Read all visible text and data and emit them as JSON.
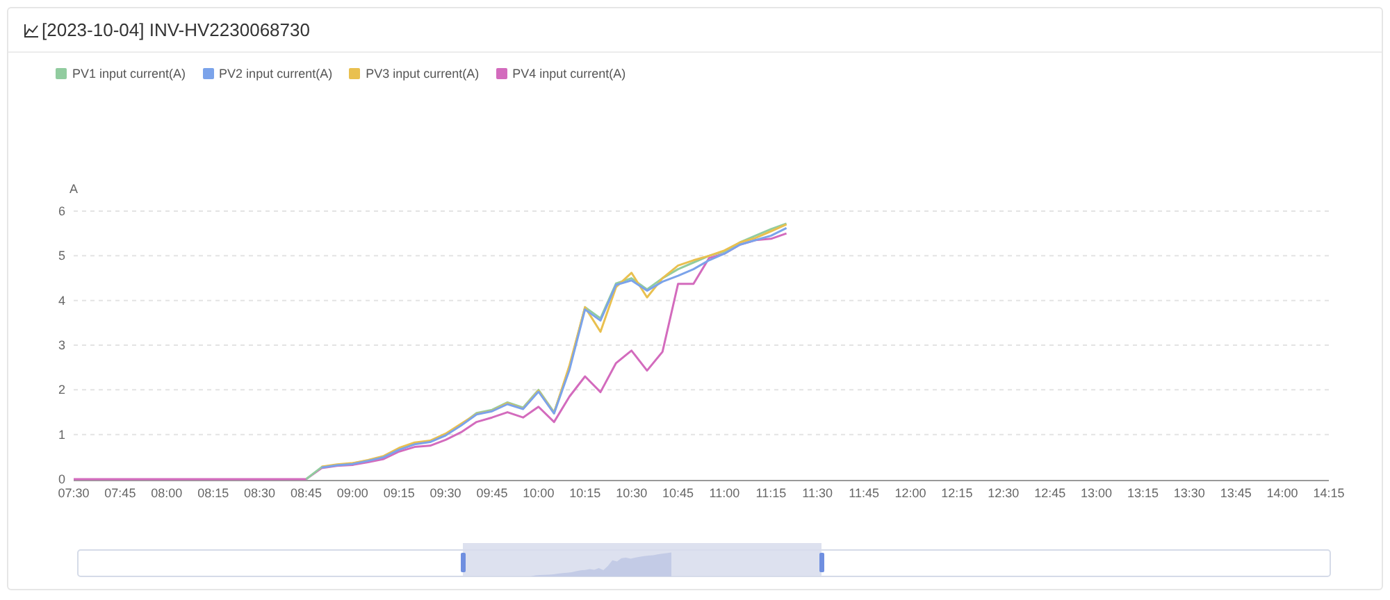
{
  "panel": {
    "title": "[2023-10-04] INV-HV2230068730"
  },
  "chart_data": {
    "type": "line",
    "grid": true,
    "ylabel": "A",
    "yticks": [
      0,
      1,
      2,
      3,
      4,
      5,
      6
    ],
    "ylim": [
      0,
      6
    ],
    "xlim": [
      450,
      855
    ],
    "xticks": [
      {
        "value": 450,
        "label": "07:30"
      },
      {
        "value": 465,
        "label": "07:45"
      },
      {
        "value": 480,
        "label": "08:00"
      },
      {
        "value": 495,
        "label": "08:15"
      },
      {
        "value": 510,
        "label": "08:30"
      },
      {
        "value": 525,
        "label": "08:45"
      },
      {
        "value": 540,
        "label": "09:00"
      },
      {
        "value": 555,
        "label": "09:15"
      },
      {
        "value": 570,
        "label": "09:30"
      },
      {
        "value": 585,
        "label": "09:45"
      },
      {
        "value": 600,
        "label": "10:00"
      },
      {
        "value": 615,
        "label": "10:15"
      },
      {
        "value": 630,
        "label": "10:30"
      },
      {
        "value": 645,
        "label": "10:45"
      },
      {
        "value": 660,
        "label": "11:00"
      },
      {
        "value": 675,
        "label": "11:15"
      },
      {
        "value": 690,
        "label": "11:30"
      },
      {
        "value": 705,
        "label": "11:45"
      },
      {
        "value": 720,
        "label": "12:00"
      },
      {
        "value": 735,
        "label": "12:15"
      },
      {
        "value": 750,
        "label": "12:30"
      },
      {
        "value": 765,
        "label": "12:45"
      },
      {
        "value": 780,
        "label": "13:00"
      },
      {
        "value": 795,
        "label": "13:15"
      },
      {
        "value": 810,
        "label": "13:30"
      },
      {
        "value": 825,
        "label": "13:45"
      },
      {
        "value": 840,
        "label": "14:00"
      },
      {
        "value": 855,
        "label": "14:15"
      }
    ],
    "x": [
      450,
      455,
      460,
      465,
      470,
      475,
      480,
      485,
      490,
      495,
      500,
      505,
      510,
      515,
      520,
      525,
      530,
      535,
      540,
      545,
      550,
      555,
      560,
      565,
      570,
      575,
      580,
      585,
      590,
      595,
      600,
      605,
      610,
      615,
      620,
      625,
      630,
      635,
      640,
      645,
      650,
      655,
      660,
      665,
      670,
      675,
      680
    ],
    "series": [
      {
        "name": "PV1 input current(A)",
        "color": "#91cc9f",
        "values": [
          null,
          null,
          null,
          null,
          null,
          null,
          null,
          null,
          null,
          null,
          null,
          null,
          null,
          null,
          null,
          0,
          0.27,
          0.32,
          0.35,
          0.42,
          0.5,
          0.68,
          0.8,
          0.85,
          1.0,
          1.22,
          1.48,
          1.55,
          1.72,
          1.6,
          2.0,
          1.5,
          2.5,
          3.85,
          3.6,
          4.38,
          4.5,
          4.25,
          4.5,
          4.7,
          4.85,
          5.0,
          5.1,
          5.3,
          5.45,
          5.6,
          5.72
        ]
      },
      {
        "name": "PV2 input current(A)",
        "color": "#7ba3ea",
        "values": [
          null,
          null,
          null,
          null,
          null,
          null,
          null,
          null,
          null,
          null,
          null,
          null,
          null,
          null,
          null,
          null,
          0.26,
          0.31,
          0.34,
          0.41,
          0.49,
          0.66,
          0.78,
          0.83,
          0.98,
          1.2,
          1.45,
          1.52,
          1.68,
          1.57,
          1.96,
          1.47,
          2.45,
          3.8,
          3.55,
          4.35,
          4.45,
          4.22,
          4.42,
          4.55,
          4.7,
          4.9,
          5.05,
          5.25,
          5.35,
          5.45,
          5.62
        ]
      },
      {
        "name": "PV3 input current(A)",
        "color": "#e9c04f",
        "values": [
          null,
          null,
          null,
          null,
          null,
          null,
          null,
          null,
          null,
          null,
          null,
          null,
          null,
          null,
          null,
          null,
          0.28,
          0.33,
          0.36,
          0.43,
          0.52,
          0.7,
          0.82,
          0.86,
          1.02,
          1.24,
          1.46,
          1.53,
          1.7,
          1.58,
          1.98,
          1.48,
          2.55,
          3.85,
          3.3,
          4.3,
          4.62,
          4.07,
          4.5,
          4.78,
          4.9,
          5.0,
          5.12,
          5.3,
          5.4,
          5.55,
          5.7
        ]
      },
      {
        "name": "PV4 input current(A)",
        "color": "#d36bbd",
        "values": [
          0,
          0,
          0,
          0,
          0,
          0,
          0,
          0,
          0,
          0,
          0,
          0,
          0,
          0,
          0,
          0,
          0.25,
          0.3,
          0.32,
          0.38,
          0.45,
          0.62,
          0.72,
          0.75,
          0.88,
          1.05,
          1.28,
          1.38,
          1.5,
          1.38,
          1.62,
          1.28,
          1.85,
          2.3,
          1.95,
          2.6,
          2.88,
          2.43,
          2.85,
          4.37,
          4.37,
          4.95,
          5.05,
          5.25,
          5.35,
          5.38,
          5.5
        ]
      }
    ]
  }
}
